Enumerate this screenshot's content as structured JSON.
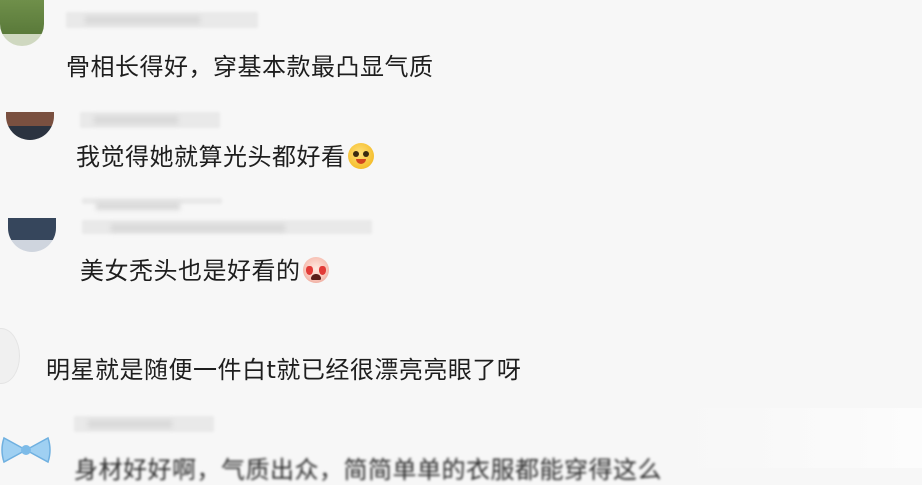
{
  "comments": [
    {
      "text": "骨相长得好，穿基本款最凸显气质"
    },
    {
      "text": "我觉得她就算光头都好看",
      "emoji": "laughing-face-emoji"
    },
    {
      "text": "美女秃头也是好看的",
      "emoji": "crying-face-emoji"
    },
    {
      "text": "明星就是随便一件白t就已经很漂亮亮眼了呀"
    },
    {
      "text": "身材好好啊，气质出众，简简单单的衣服都能穿得这么"
    }
  ],
  "colors": {
    "background": "#f7f7f7",
    "text": "#1e1e1e",
    "bow_blue": "#8ec5ec"
  }
}
